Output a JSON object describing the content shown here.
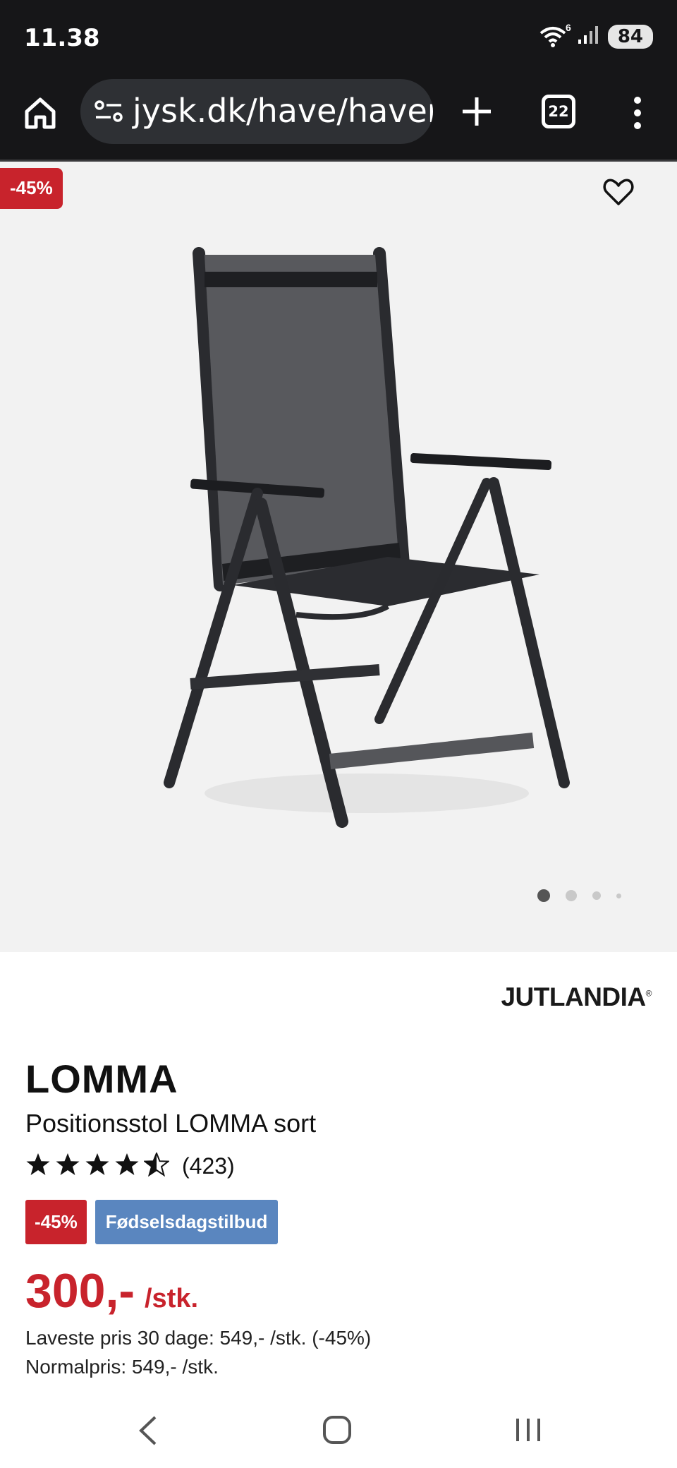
{
  "status_bar": {
    "time": "11.38",
    "wifi_badge": "6",
    "battery": "84",
    "icons": [
      "wifi-icon",
      "signal-icon",
      "battery-icon"
    ]
  },
  "browser": {
    "url": "jysk.dk/have/havem",
    "tab_count": "22",
    "icons": [
      "home-icon",
      "site-settings-icon",
      "new-tab-icon",
      "tabs-icon",
      "more-icon"
    ]
  },
  "product": {
    "image_discount": "-45%",
    "carousel_dots": 4,
    "carousel_active": 1,
    "brand": "JUTLANDIA",
    "brand_mark": "®",
    "name": "LOMMA",
    "subtitle": "Positionsstol LOMMA sort",
    "rating": 4.5,
    "rating_max": 5,
    "reviews": "(423)",
    "badge_discount": "-45%",
    "badge_offer": "Fødselsdagstilbud",
    "price": "300,-",
    "price_unit": "/stk.",
    "lowest_price": "Laveste pris 30 dage: 549,- /stk. (-45%)",
    "normal_price": "Normalpris: 549,- /stk."
  },
  "colors": {
    "sale_red": "#c8232c",
    "offer_blue": "#5a86bf",
    "system_bar": "#161618",
    "hero_bg": "#f2f2f2"
  }
}
